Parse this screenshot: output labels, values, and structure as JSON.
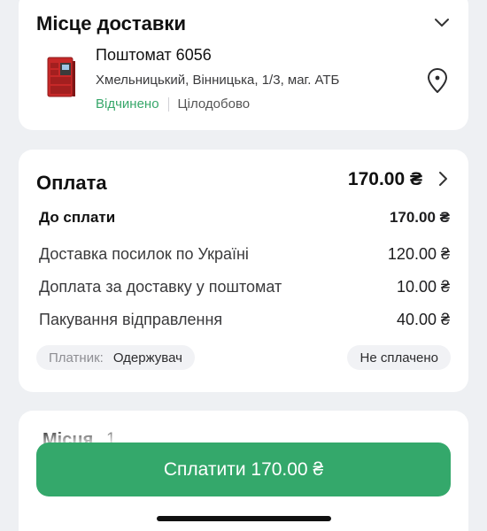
{
  "delivery": {
    "title": "Місце доставки",
    "locker_name": "Поштомат 6056",
    "address": "Хмельницький, Вінницька, 1/3, маг. АТБ",
    "status_open": "Відчинено",
    "hours": "Цілодобово",
    "icons": [
      "chevron-down-icon",
      "parcel-locker-image",
      "map-pin-icon"
    ]
  },
  "payment": {
    "title": "Оплата",
    "total": "170.00 ₴",
    "due_label": "До сплати",
    "due_amount": "170.00 ₴",
    "items": [
      {
        "label": "Доставка посилок по Україні",
        "amount": "120.00 ₴"
      },
      {
        "label": "Доплата за доставку у поштомат",
        "amount": "10.00 ₴"
      },
      {
        "label": "Пакування відправлення",
        "amount": "40.00 ₴"
      }
    ],
    "payer_label": "Платник:",
    "payer_value": "Одержувач",
    "paid_status": "Не сплачено"
  },
  "places": {
    "title": "Місця",
    "count": "1"
  },
  "pay_button": {
    "label": "Сплатити 170.00 ₴"
  },
  "colors": {
    "accent_green": "#34a86b",
    "status_green": "#37a76a",
    "background": "#eef0f3"
  }
}
